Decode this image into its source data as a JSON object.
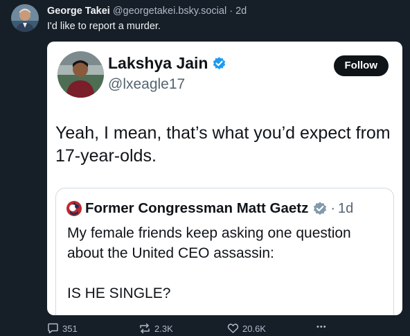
{
  "post": {
    "author_name": "George Takei",
    "author_handle": "@georgetakei.bsky.social",
    "separator": "·",
    "time": "2d",
    "text": "I'd like to report a murder."
  },
  "embed": {
    "name": "Lakshya Jain",
    "handle": "@lxeagle17",
    "follow_label": "Follow",
    "text": "Yeah, I mean, that’s what you’d expect from 17-year-olds.",
    "quote": {
      "name": "Former Congressman Matt Gaetz",
      "separator": "·",
      "time": "1d",
      "text_line1": "My female friends keep asking one question about the United CEO assassin:",
      "text_line2": "IS HE SINGLE?"
    }
  },
  "actions": {
    "replies": "351",
    "reposts": "2.3K",
    "likes": "20.6K",
    "more": "•••"
  },
  "colors": {
    "background": "#161e27",
    "verified": "#1d9bf0",
    "quote_verified": "#829aab",
    "follow_bg": "#0f1419"
  },
  "icons": [
    "reply-icon",
    "repost-icon",
    "like-icon",
    "more-icon",
    "verified-badge-icon"
  ]
}
